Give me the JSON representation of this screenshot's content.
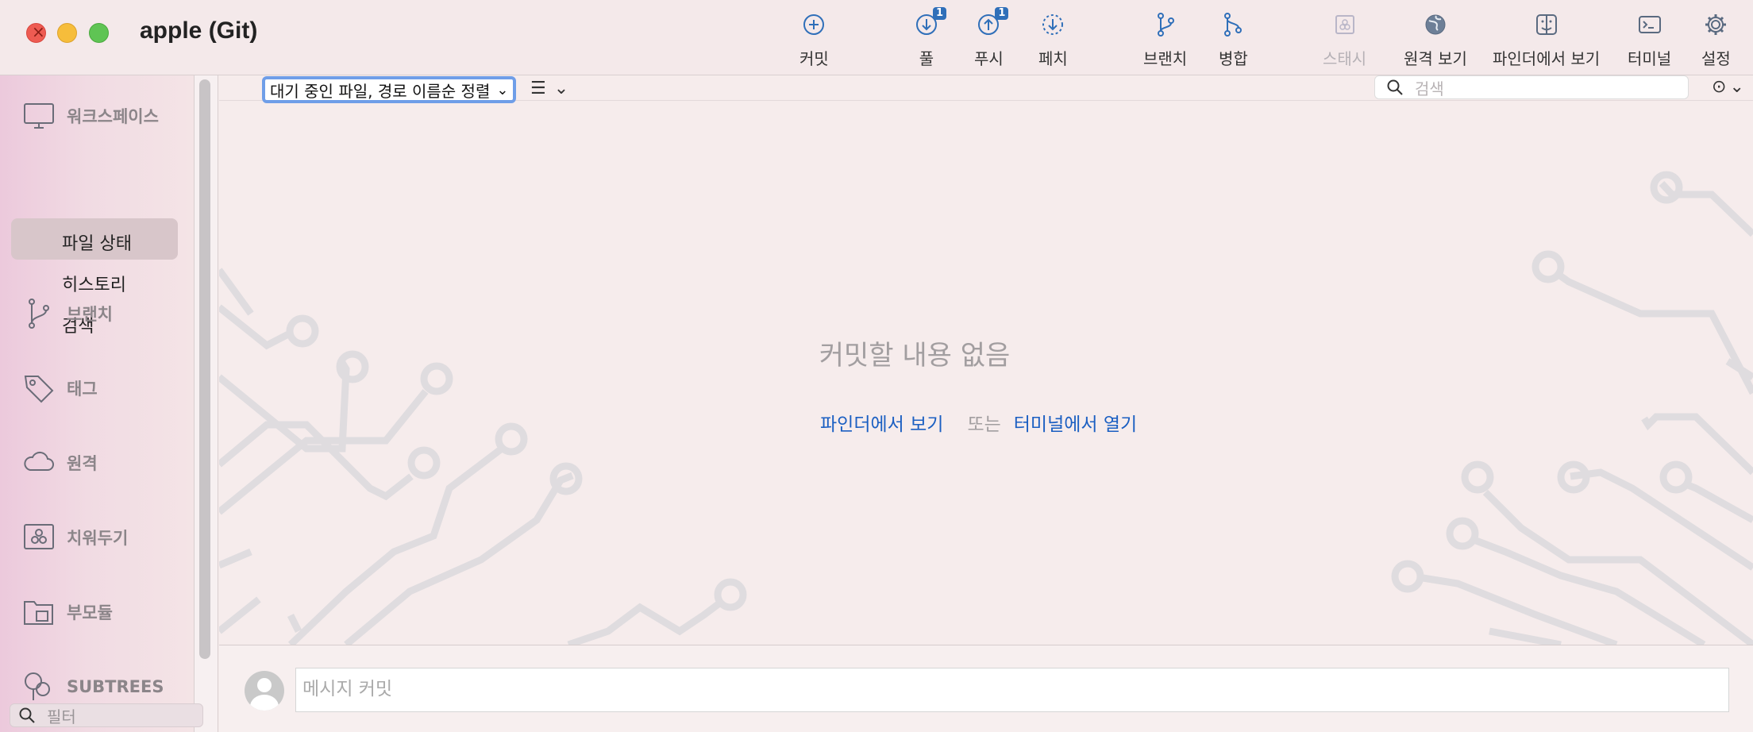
{
  "window": {
    "title": "apple (Git)"
  },
  "toolbar": {
    "buttons": [
      {
        "label": "커밋",
        "icon": "plus-circle-icon"
      },
      {
        "label": "풀",
        "icon": "pull-icon",
        "badge": "1"
      },
      {
        "label": "푸시",
        "icon": "push-icon",
        "badge": "1"
      },
      {
        "label": "페치",
        "icon": "fetch-icon"
      },
      {
        "label": "브랜치",
        "icon": "branch-icon"
      },
      {
        "label": "병합",
        "icon": "merge-icon"
      },
      {
        "label": "스태시",
        "icon": "stash-icon",
        "disabled": true
      },
      {
        "label": "원격 보기",
        "icon": "globe-icon"
      },
      {
        "label": "파인더에서 보기",
        "icon": "finder-icon"
      },
      {
        "label": "터미널",
        "icon": "terminal-icon"
      },
      {
        "label": "설정",
        "icon": "gear-icon"
      }
    ]
  },
  "sidebar": {
    "workspace_label": "워크스페이스",
    "items": [
      {
        "label": "파일 상태",
        "selected": true
      },
      {
        "label": "히스토리"
      },
      {
        "label": "검색"
      }
    ],
    "sections": [
      {
        "label": "브랜치",
        "icon": "branch-icon"
      },
      {
        "label": "태그",
        "icon": "tag-icon"
      },
      {
        "label": "원격",
        "icon": "cloud-icon"
      },
      {
        "label": "치워두기",
        "icon": "stash-icon"
      },
      {
        "label": "부모듈",
        "icon": "submodule-icon"
      },
      {
        "label": "SUBTREES",
        "icon": "subtree-icon"
      }
    ],
    "filter_placeholder": "필터"
  },
  "main": {
    "sort_select": "대기 중인 파일, 경로 이름순 정렬",
    "search_placeholder": "검색",
    "empty_title": "커밋할 내용 없음",
    "link_finder": "파인더에서 보기",
    "or_text": "또는",
    "link_terminal": "터미널에서 열기"
  },
  "commit": {
    "placeholder": "메시지 커밋"
  },
  "colors": {
    "accent": "#1b5fc2",
    "badge": "#2f6fb9",
    "focus_ring": "#6f9ee8"
  }
}
